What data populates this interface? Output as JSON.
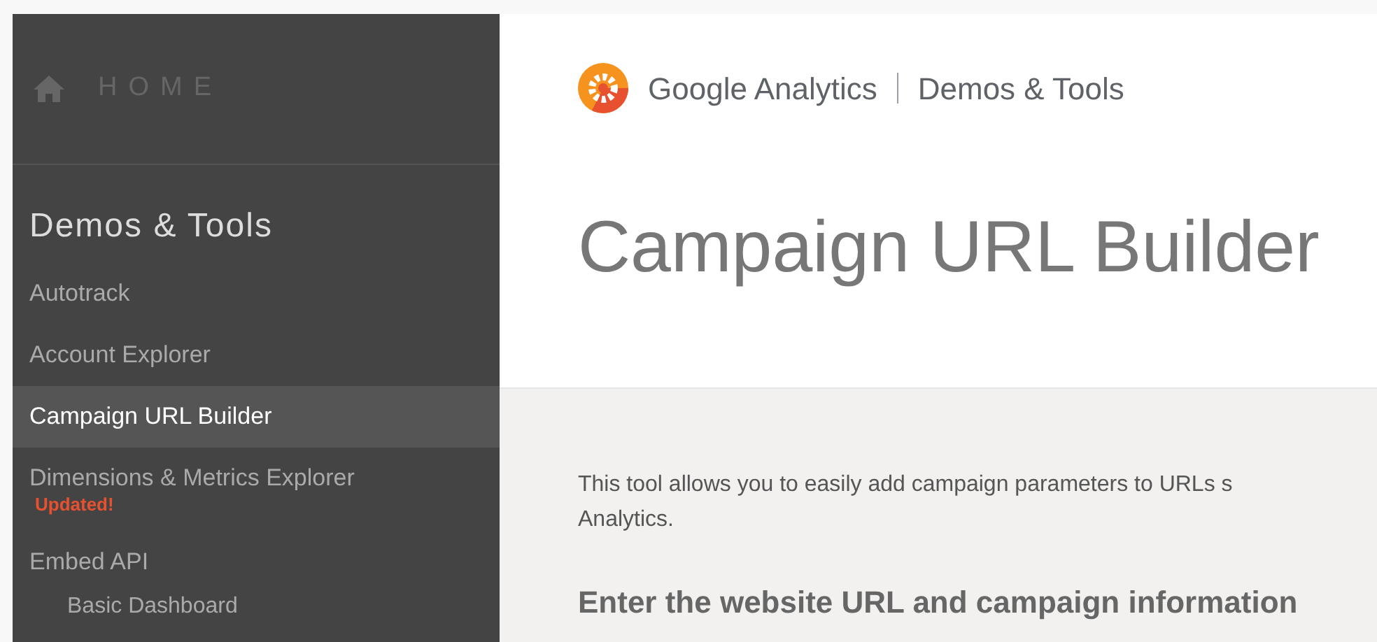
{
  "sidebar": {
    "home": {
      "label": "HOME"
    },
    "section_title": "Demos & Tools",
    "items": [
      {
        "label": "Autotrack",
        "selected": false
      },
      {
        "label": "Account Explorer",
        "selected": false
      },
      {
        "label": "Campaign URL Builder",
        "selected": true
      },
      {
        "label": "Dimensions & Metrics Explorer",
        "selected": false,
        "badge": "Updated!"
      },
      {
        "label": "Embed API",
        "selected": false,
        "children": [
          {
            "label": "Basic Dashboard",
            "selected": false
          }
        ]
      }
    ]
  },
  "header": {
    "brand": "Google Analytics",
    "product": "Demos & Tools",
    "page_title": "Campaign URL Builder"
  },
  "content": {
    "intro_lines": [
      "This tool allows you to easily add campaign parameters to URLs s",
      "Analytics."
    ],
    "section_heading": "Enter the website URL and campaign information"
  }
}
